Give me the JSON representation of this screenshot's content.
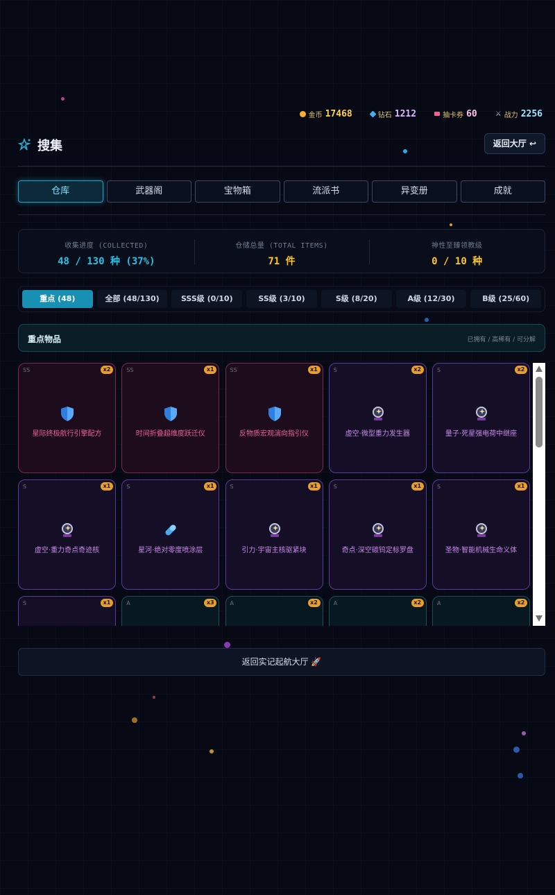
{
  "currency": [
    {
      "label": "金币",
      "value": "17468",
      "color": "#ffd24a",
      "icon": "coin-icon"
    },
    {
      "label": "钻石",
      "value": "1212",
      "color": "#d9b8ff",
      "icon": "diamond-icon"
    },
    {
      "label": "抽卡券",
      "value": "60",
      "color": "#ffc0e8",
      "icon": "ticket-icon"
    },
    {
      "label": "战力",
      "value": "2256",
      "color": "#9fe7ff",
      "icon": "crossed-swords-icon"
    }
  ],
  "header": {
    "title": "搜集",
    "back_label": "返回大厅 ↩"
  },
  "tabs": [
    "仓库",
    "武器阁",
    "宝物箱",
    "流派书",
    "异变册",
    "成就"
  ],
  "stats": [
    {
      "label": "收集进度 (COLLECTED)",
      "value": "48 / 130 种 (37%)",
      "color": "#27c1e8"
    },
    {
      "label": "仓储总量 (TOTAL ITEMS)",
      "value": "71 件",
      "color": "#ffc829"
    },
    {
      "label": "神性至臻领教级",
      "value": "0 / 10 种",
      "color": "#ffc829"
    }
  ],
  "filters": [
    "重点 (48)",
    "全部 (48/130)",
    "SSS级 (0/10)",
    "SS级 (3/10)",
    "S级 (8/20)",
    "A级 (12/30)",
    "B级 (25/60)"
  ],
  "section": {
    "title": "重点物品",
    "hint": "已拥有 / 高稀有 / 可分解"
  },
  "items": [
    {
      "grade": "SS",
      "qty": "x2",
      "name": "星际终极航行引擎配方",
      "icon": "shield-icon"
    },
    {
      "grade": "SS",
      "qty": "x1",
      "name": "时间折叠超维度跃迁仪",
      "icon": "shield-icon"
    },
    {
      "grade": "SS",
      "qty": "x1",
      "name": "反物质宏观湍向指引仪",
      "icon": "shield-icon"
    },
    {
      "grade": "S",
      "qty": "x2",
      "name": "虚空·微型重力发生器",
      "icon": "crystal-ball-icon"
    },
    {
      "grade": "S",
      "qty": "x2",
      "name": "量子·死星强电荷中继座",
      "icon": "crystal-ball-icon"
    },
    {
      "grade": "S",
      "qty": "x1",
      "name": "虚空·重力奇点奇迹核",
      "icon": "crystal-ball-icon"
    },
    {
      "grade": "S",
      "qty": "x1",
      "name": "星河·绝对零度喷涂层",
      "icon": "pill-icon"
    },
    {
      "grade": "S",
      "qty": "x1",
      "name": "引力·宇宙主核驱紧块",
      "icon": "crystal-ball-icon"
    },
    {
      "grade": "S",
      "qty": "x1",
      "name": "奇点·深空碳钨定标罗盘",
      "icon": "crystal-ball-icon"
    },
    {
      "grade": "S",
      "qty": "x1",
      "name": "圣物·智能机械生命义体",
      "icon": "crystal-ball-icon"
    },
    {
      "grade": "S",
      "qty": "x1",
      "name": "",
      "icon": ""
    },
    {
      "grade": "A",
      "qty": "x3",
      "name": "",
      "icon": ""
    },
    {
      "grade": "A",
      "qty": "x2",
      "name": "",
      "icon": ""
    },
    {
      "grade": "A",
      "qty": "x2",
      "name": "",
      "icon": ""
    },
    {
      "grade": "A",
      "qty": "x2",
      "name": "",
      "icon": ""
    }
  ],
  "footer": {
    "label": "返回实记起航大厅 🚀"
  }
}
